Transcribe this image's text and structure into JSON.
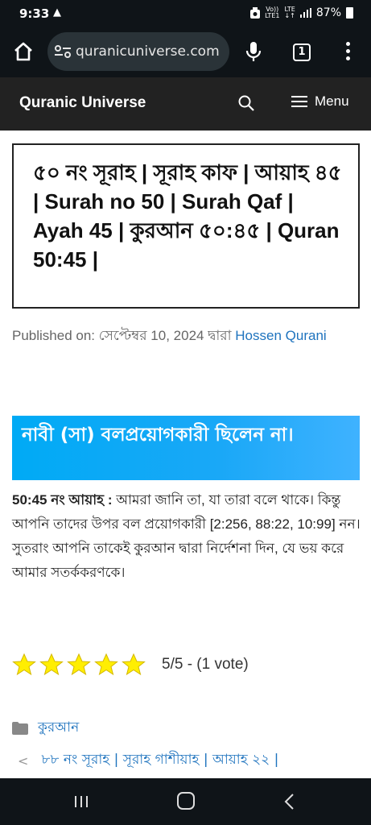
{
  "status_bar": {
    "time": "9:33",
    "alert_glyph": "▲",
    "volte": "Vo))",
    "lte_top": "LTE",
    "lte_bottom": "LTE1",
    "battery": "87%"
  },
  "browser": {
    "url": "quranicuniverse.com",
    "tab_count": "1",
    "icons": [
      "home-icon",
      "tune-icon",
      "mic-icon",
      "tab-switcher-icon",
      "more-vert-icon"
    ]
  },
  "site_header": {
    "title": "Quranic Universe",
    "menu_label": "Menu"
  },
  "article": {
    "title": "৫০ নং সূরাহ | সূরাহ কাফ | আয়াহ ৪৫ | Surah no 50 | Surah Qaf | Ayah 45 | কুরআন ৫০:৪৫ | Quran 50:45 |",
    "published_prefix": "Published on:",
    "published_date": "সেপ্টেম্বর 10, 2024",
    "by_word": "দ্বারা",
    "author": "Hossen Qurani",
    "heading": "নাবী (সা) বলপ্রয়োগকারী ছিলেন না।",
    "verse_label": "50:45 নং আয়াহ :",
    "verse_text": "আমরা জানি তা, যা তারা বলে থাকে। কিন্তু আপনি তাদের উপর বল প্রয়োগকারী [2:256, 88:22, 10:99] নন। সুতরাং আপনি তাকেই কুরআন দ্বারা নির্দেশনা দিন, যে ভয় করে আমার সতর্ককরণকে।",
    "rating": {
      "score": 5,
      "max": 5,
      "text": "5/5 - (1 vote)"
    },
    "category": "কুরআন",
    "prev_post": "৮৮ নং সূরাহ | সূরাহ গাশীয়াহ | আয়াহ ২২ |"
  },
  "colors": {
    "bar_dark": "#0f1418",
    "header_dark": "#222222",
    "link_blue": "#1e73be",
    "heading_blue": "#00aaf5",
    "star_yellow": "#ffee02"
  }
}
